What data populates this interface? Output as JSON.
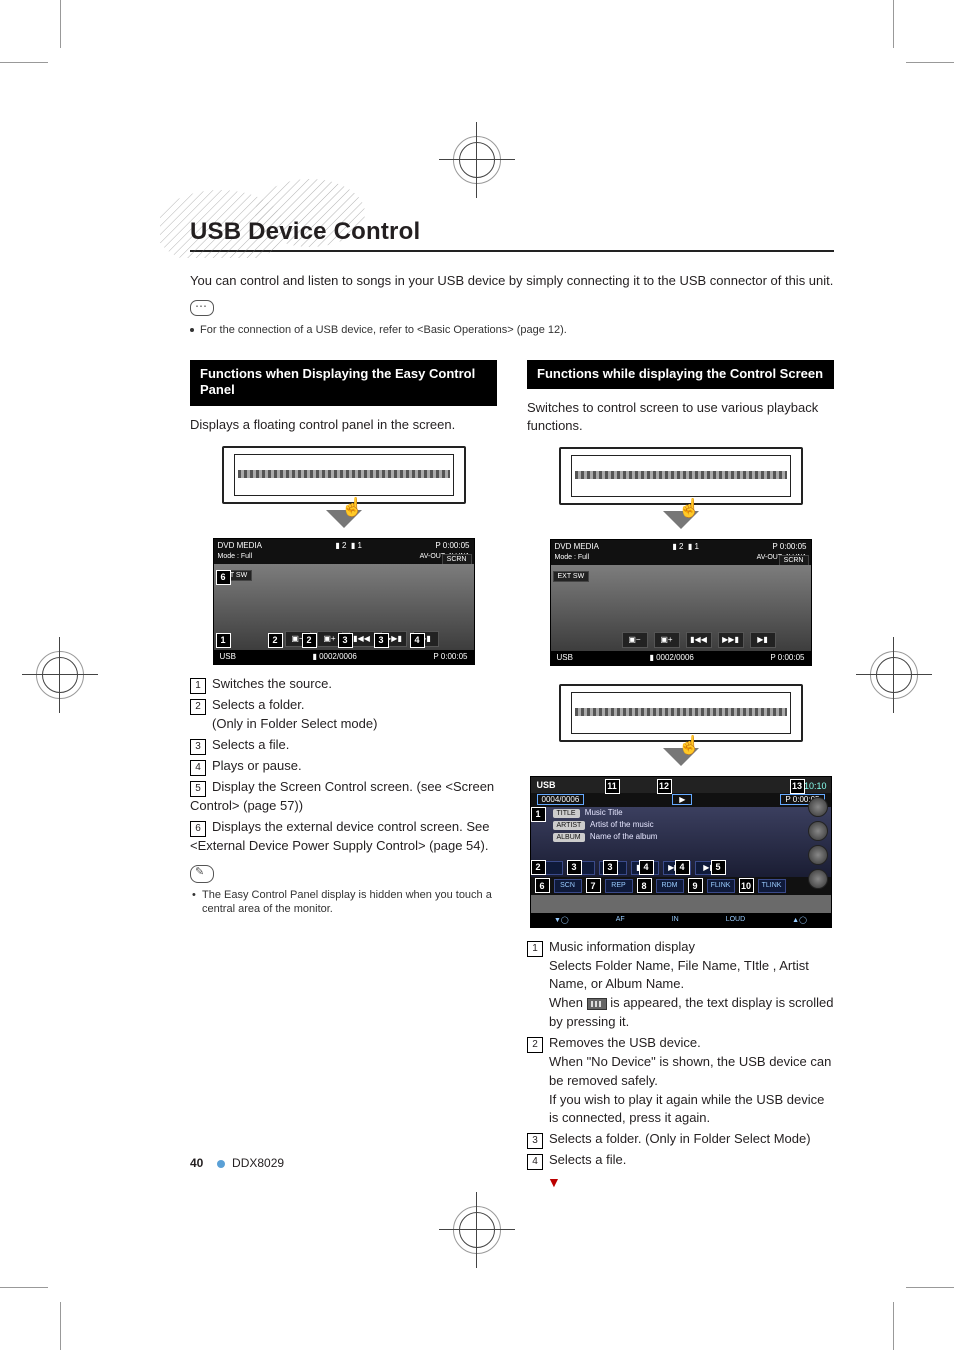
{
  "page_number": "40",
  "model": "DDX8029",
  "title": "USB Device Control",
  "intro": "You can control and listen to songs in your USB device by simply connecting it to the USB connector of this unit.",
  "connection_note": "For the connection of a USB device, refer to <Basic Operations> (page 12).",
  "left": {
    "heading": "Functions when Displaying the Easy Control Panel",
    "desc": "Displays a floating control panel in the screen.",
    "shot": {
      "src_label": "DVD MEDIA",
      "chap": "2",
      "trk": "1",
      "time": "P  0:00:05",
      "mode": "Mode : Full",
      "avout": "AV-OUT: AV-IN1",
      "scrn": "SCRN",
      "extsw": "EXT SW",
      "foot_src": "USB",
      "foot_count": "0002/0006",
      "foot_time": "P     0:00:05"
    },
    "items": [
      {
        "n": "1",
        "text": "Switches the source."
      },
      {
        "n": "2",
        "text": "Selects a folder.",
        "sub": "(Only in Folder Select mode)"
      },
      {
        "n": "3",
        "text": "Selects a file."
      },
      {
        "n": "4",
        "text": "Plays or pause."
      },
      {
        "n": "5",
        "text": "Display the Screen Control screen. (see <Screen Control> (page 57))"
      },
      {
        "n": "6",
        "text": "Displays the external device control screen. See <External Device Power Supply Control> (page 54)."
      }
    ],
    "tip": "The Easy Control Panel display is hidden when you touch a central area of the monitor."
  },
  "right": {
    "heading": "Functions while displaying the Control Screen",
    "desc": "Switches to control screen to use various playback functions.",
    "shot": {
      "src_label": "DVD MEDIA",
      "chap": "2",
      "trk": "1",
      "time": "P  0:00:05",
      "mode": "Mode : Full",
      "avout": "AV-OUT: AV-IN1",
      "scrn": "SCRN",
      "extsw": "EXT SW",
      "foot_src": "USB",
      "foot_count": "0002/0006",
      "foot_time": "P     0:00:05"
    },
    "ctrl": {
      "src": "USB",
      "count": "0004/0006",
      "play": "▶",
      "ptime": "P   0:00:05",
      "clock": "10:10",
      "title_tag": "TITLE",
      "title_val": "Music Title",
      "artist_tag": "ARTIST",
      "artist_val": "Artist of the music",
      "album_tag": "ALBUM",
      "album_val": "Name of the album",
      "btn_scn": "SCN",
      "btn_rep": "REP",
      "btn_rdm": "RDM",
      "btn_flink": "FLINK",
      "btn_tlink": "TLINK",
      "foot_af": "AF",
      "foot_in": "IN",
      "foot_loud": "LOUD"
    },
    "items": [
      {
        "n": "1",
        "text": "Music information display",
        "subs": [
          "Selects Folder Name, File Name, TItle , Artist Name, or Album Name.",
          "When __SCROLL__ is appeared, the text display is scrolled by pressing it."
        ]
      },
      {
        "n": "2",
        "text": "Removes the USB device.",
        "subs": [
          "When \"No Device\" is shown, the USB device can be removed safely.",
          "If you wish to play it again while the USB device is connected, press it again."
        ]
      },
      {
        "n": "3",
        "text": "Selects a folder. (Only in Folder Select Mode)"
      },
      {
        "n": "4",
        "text": "Selects a file."
      }
    ]
  }
}
